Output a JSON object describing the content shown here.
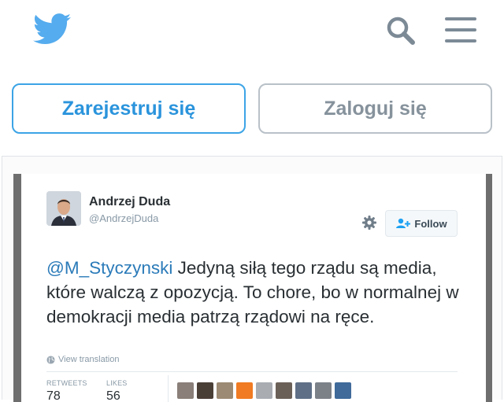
{
  "header": {
    "logo_icon": "twitter-bird-icon",
    "search_icon": "search-icon",
    "menu_icon": "hamburger-menu-icon",
    "brand_color": "#55acee"
  },
  "actions": {
    "signup_label": "Zarejestruj się",
    "login_label": "Zaloguj się"
  },
  "tweet": {
    "author_name": "Andrzej Duda",
    "author_handle": "@AndrzejDuda",
    "follow_label": "Follow",
    "mention": "@M_Styczynski",
    "text": " Jedyną siłą tego rządu są media, które walczą z opozycją. To chore, bo w normalnej w demokracji media patrzą rządowi na ręce.",
    "translate_label": "View translation",
    "retweets_label": "RETWEETS",
    "retweets_count": "78",
    "likes_label": "LIKES",
    "likes_count": "56",
    "liker_avatar_colors": [
      "#8a7f79",
      "#4a3f37",
      "#9c8a74",
      "#f07b22",
      "#a9adb2",
      "#6b6058",
      "#5f6f86",
      "#7c8188",
      "#3f6a9a"
    ]
  }
}
